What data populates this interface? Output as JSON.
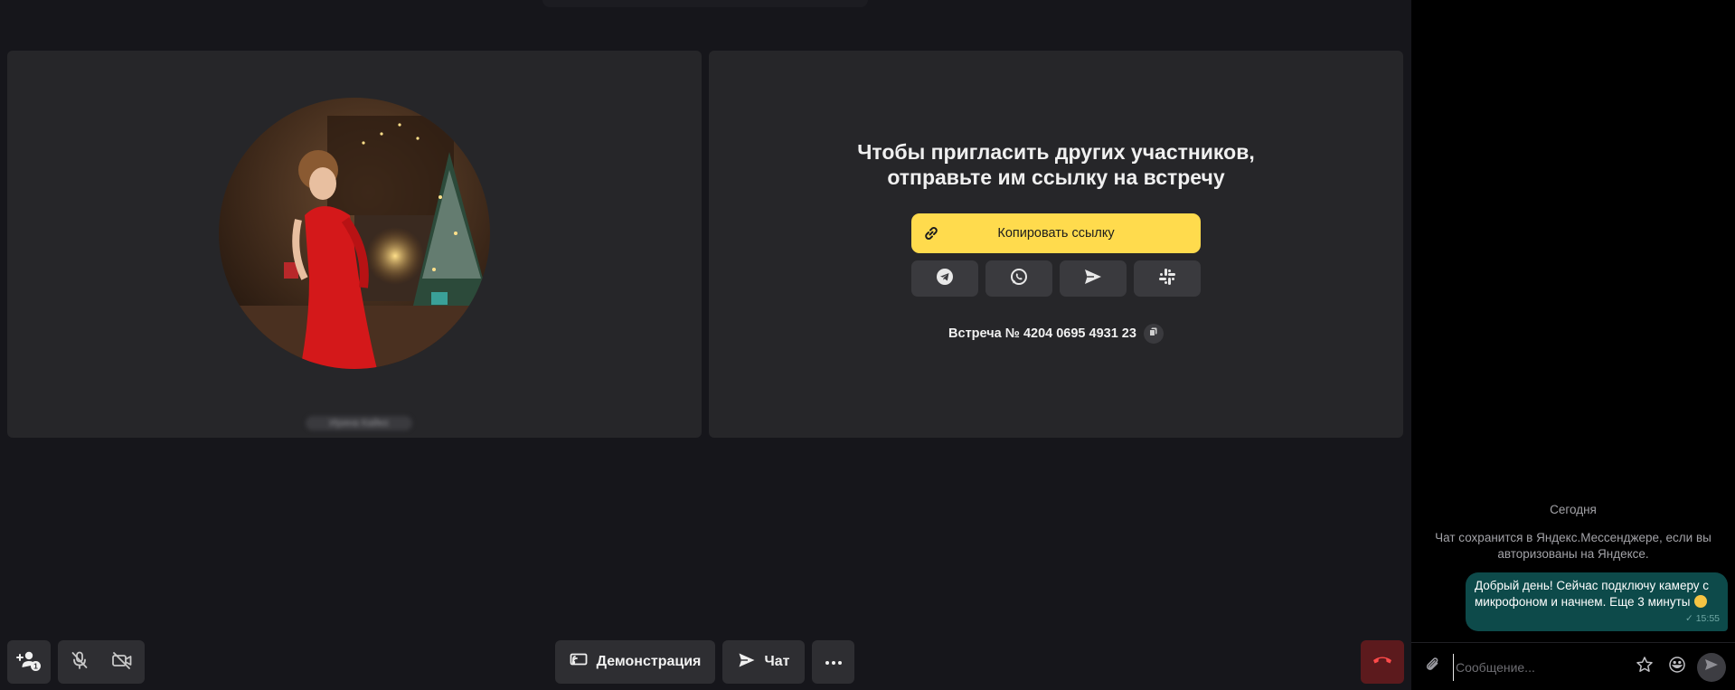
{
  "invite": {
    "title_line1": "Чтобы пригласить других участников,",
    "title_line2": "отправьте им ссылку на встречу",
    "copy_link_label": "Копировать ссылку",
    "meeting_label": "Встреча № 4204 0695 4931 23",
    "share_options": [
      "telegram-icon",
      "whatsapp-icon",
      "send-icon",
      "slack-icon"
    ]
  },
  "participant": {
    "name": "Ирина Кайко"
  },
  "toolbar": {
    "add_participant_badge": "1",
    "demo_label": "Демонстрация",
    "chat_label": "Чат"
  },
  "chat": {
    "date_label": "Сегодня",
    "notice": "Чат сохранится в Яндекс.Мессенджере, если вы авторизованы на Яндексе.",
    "messages": [
      {
        "text": "Добрый день! Сейчас подключу камеру с микрофоном и начнем. Еще 3 минуты",
        "time": "15:55",
        "status": "✓"
      }
    ],
    "input_placeholder": "Сообщение..."
  },
  "colors": {
    "accent": "#ffdb4d",
    "background": "#16161b",
    "tile": "#262629",
    "bubble": "#0d4a4a",
    "end_call": "#5c1a1d"
  }
}
